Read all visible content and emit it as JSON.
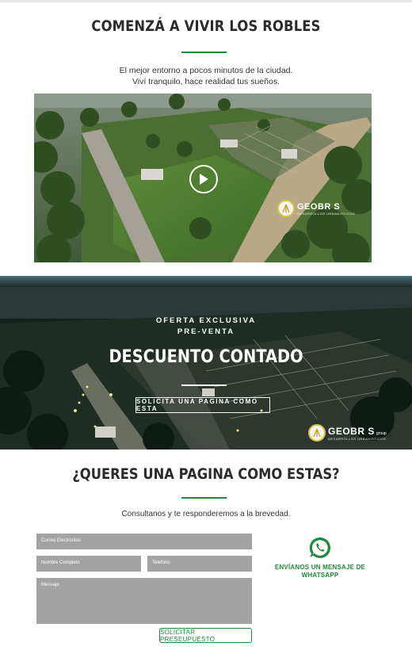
{
  "hero": {
    "title": "COMENZÁ A VIVIR LOS ROBLES",
    "subtitle_line1": "El mejor entorno a pocos minutos de la ciudad.",
    "subtitle_line2": "Viví tranquilo, hace realidad tus sueños."
  },
  "video": {
    "play_icon": "play-icon",
    "logo_text": "GEOBR S",
    "logo_subtext": "DESARROLLOS URBANISTICOS"
  },
  "banner": {
    "line1": "OFERTA EXCLUSIVA",
    "line2": "PRE-VENTA",
    "title": "DESCUENTO CONTADO",
    "button_label": "SOLICITA UNA PAGINA COMO ESTA",
    "logo_text": "GEOBR S",
    "logo_group": "group",
    "logo_subtext": "DESARROLLOS URBANISTICOS"
  },
  "contact": {
    "title": "¿QUERES UNA PAGINA COMO ESTAS?",
    "subtitle": "Consultanos y te responderemos a la brevedad.",
    "fields": {
      "email_placeholder": "Correo Electronico",
      "name_placeholder": "Nombre Completo",
      "phone_placeholder": "Telefono",
      "message_placeholder": "Mensaje"
    },
    "submit_label": "SOLICITAR PRESEUPUESTO",
    "whatsapp_icon": "whatsapp-icon",
    "whatsapp_line1": "ENVÍANOS UN MENSAJE DE",
    "whatsapp_line2": "WHATSAPP"
  },
  "colors": {
    "accent_green": "#1e8a3a",
    "field_gray": "#a3a3a3",
    "title_dark": "#2b2b2b"
  }
}
